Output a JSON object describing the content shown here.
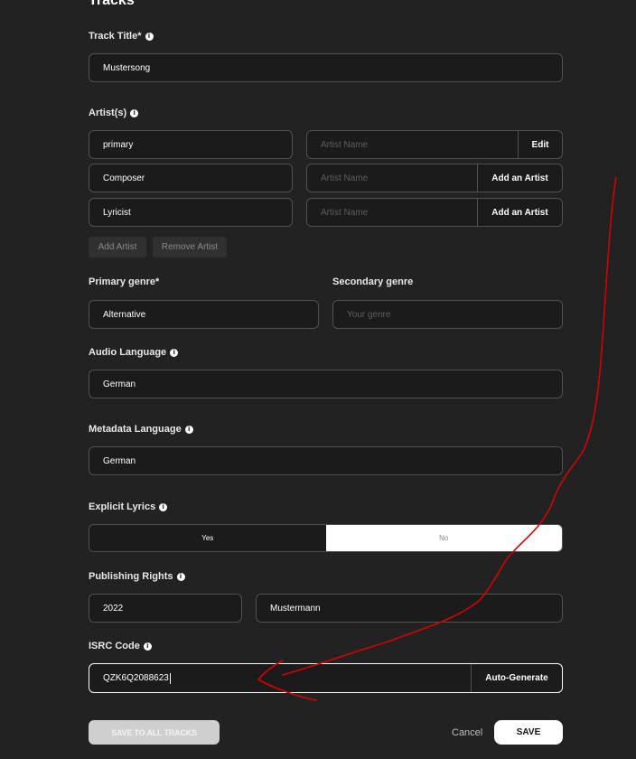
{
  "page": {
    "heading": "Tracks"
  },
  "track_title": {
    "label": "Track Title*",
    "value": "Mustersong"
  },
  "artists": {
    "label": "Artist(s)",
    "rows": [
      {
        "role": "primary",
        "name_placeholder": "Artist Name",
        "action": "Edit"
      },
      {
        "role": "Composer",
        "name_placeholder": "Artist Name",
        "action": "Add an Artist"
      },
      {
        "role": "Lyricist",
        "name_placeholder": "Artist Name",
        "action": "Add an Artist"
      }
    ],
    "add_label": "Add Artist",
    "remove_label": "Remove Artist"
  },
  "genre": {
    "primary_label": "Primary genre*",
    "primary_value": "Alternative",
    "secondary_label": "Secondary genre",
    "secondary_placeholder": "Your genre"
  },
  "audio_language": {
    "label": "Audio Language",
    "value": "German"
  },
  "metadata_language": {
    "label": "Metadata Language",
    "value": "German"
  },
  "explicit": {
    "label": "Explicit Lyrics",
    "yes": "Yes",
    "no": "No",
    "selected": "No"
  },
  "publishing": {
    "label": "Publishing Rights",
    "year": "2022",
    "owner": "Mustermann"
  },
  "isrc": {
    "label": "ISRC Code",
    "value": "QZK6Q2088623",
    "auto_label": "Auto-Generate"
  },
  "footer": {
    "save_all": "SAVE TO ALL TRACKS",
    "cancel": "Cancel",
    "save": "SAVE"
  },
  "annotation": {
    "color": "#d40000"
  }
}
